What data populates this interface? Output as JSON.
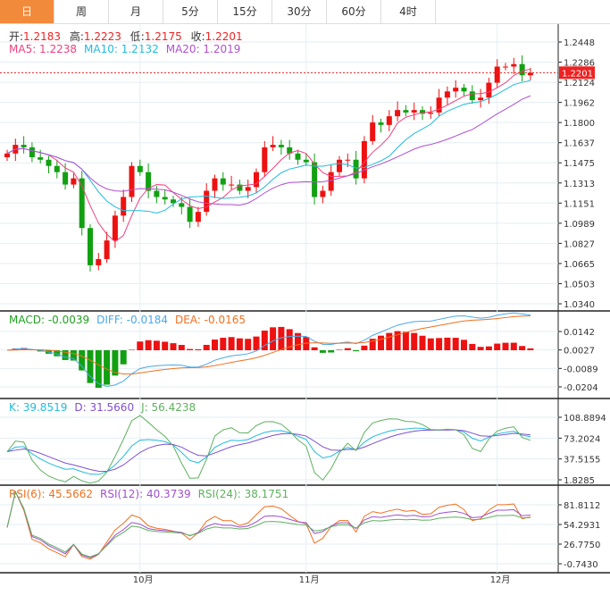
{
  "tabs": [
    "日",
    "周",
    "月",
    "5分",
    "15分",
    "30分",
    "60分",
    "4时"
  ],
  "active_tab": 0,
  "ohlc_header": {
    "open_label": "开:",
    "open": "1.2183",
    "high_label": "高:",
    "high": "1.2223",
    "low_label": "低:",
    "low": "1.2175",
    "close_label": "收:",
    "close": "1.2201"
  },
  "ma_header": {
    "ma5": "MA5: 1.2238",
    "ma10": "MA10: 1.2132",
    "ma20": "MA20: 1.2019"
  },
  "macd_header": {
    "macd": "MACD: -0.0039",
    "diff": "DIFF: -0.0184",
    "dea": "DEA: -0.0165"
  },
  "kdj_header": {
    "k": "K: 39.8519",
    "d": "D: 31.5660",
    "j": "J: 56.4238"
  },
  "rsi_header": {
    "rsi6": "RSI(6): 45.5662",
    "rsi12": "RSI(12): 40.3739",
    "rsi24": "RSI(24): 38.1751"
  },
  "current_price": "1.2201",
  "colors": {
    "up": "#ee1111",
    "down": "#11a011",
    "ma5": "#f0407f",
    "ma10": "#22bbdd",
    "ma20": "#b050d0",
    "tab_active": "#f28a3c"
  },
  "chart_data": {
    "type": "candlestick",
    "price_ticks": [
      "1.2448",
      "1.2286",
      "1.2124",
      "1.1962",
      "1.1800",
      "1.1637",
      "1.1475",
      "1.1313",
      "1.1151",
      "1.0989",
      "1.0827",
      "1.0665",
      "1.0503",
      "1.0340"
    ],
    "price_range": [
      1.034,
      1.2448
    ],
    "macd_ticks": [
      "0.0142",
      "0.0027",
      "-0.0089",
      "-0.0204"
    ],
    "kdj_ticks": [
      "108.8894",
      "73.2024",
      "37.5155",
      "1.8285"
    ],
    "rsi_ticks": [
      "81.8112",
      "54.2931",
      "26.7750",
      "-0.7430"
    ],
    "x_labels": [
      {
        "label": "10月",
        "index": 16
      },
      {
        "label": "11月",
        "index": 36
      },
      {
        "label": "12月",
        "index": 59
      }
    ],
    "closes": [
      1.155,
      1.162,
      1.16,
      1.152,
      1.15,
      1.145,
      1.14,
      1.13,
      1.135,
      1.095,
      1.065,
      1.07,
      1.085,
      1.105,
      1.12,
      1.145,
      1.14,
      1.125,
      1.12,
      1.118,
      1.115,
      1.112,
      1.1,
      1.108,
      1.125,
      1.135,
      1.13,
      1.13,
      1.125,
      1.128,
      1.14,
      1.16,
      1.162,
      1.16,
      1.155,
      1.15,
      1.148,
      1.12,
      1.125,
      1.14,
      1.15,
      1.15,
      1.135,
      1.165,
      1.18,
      1.178,
      1.185,
      1.19,
      1.188,
      1.19,
      1.187,
      1.188,
      1.2,
      1.205,
      1.208,
      1.205,
      1.198,
      1.2,
      1.212,
      1.225,
      1.225,
      1.227,
      1.218,
      1.22
    ]
  }
}
